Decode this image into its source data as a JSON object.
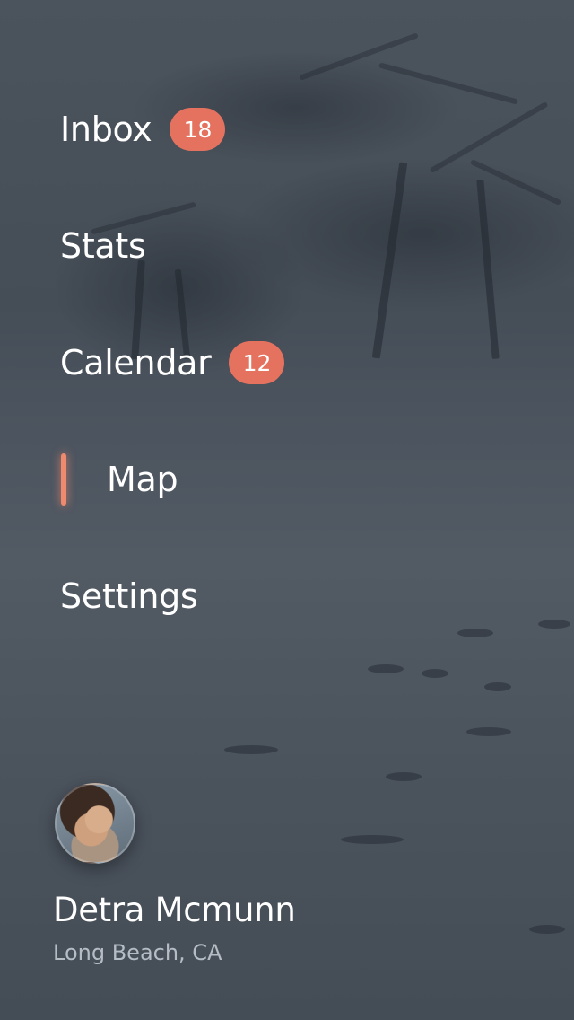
{
  "menu": {
    "items": [
      {
        "label": "Inbox",
        "badge": "18",
        "active": false
      },
      {
        "label": "Stats",
        "badge": "",
        "active": false
      },
      {
        "label": "Calendar",
        "badge": "12",
        "active": false
      },
      {
        "label": "Map",
        "badge": "",
        "active": true
      },
      {
        "label": "Settings",
        "badge": "",
        "active": false
      }
    ]
  },
  "profile": {
    "name": "Detra Mcmunn",
    "location": "Long Beach, CA"
  },
  "colors": {
    "accent": "#e4725f",
    "active_indicator": "#f08a6e",
    "background": "#48505b"
  }
}
